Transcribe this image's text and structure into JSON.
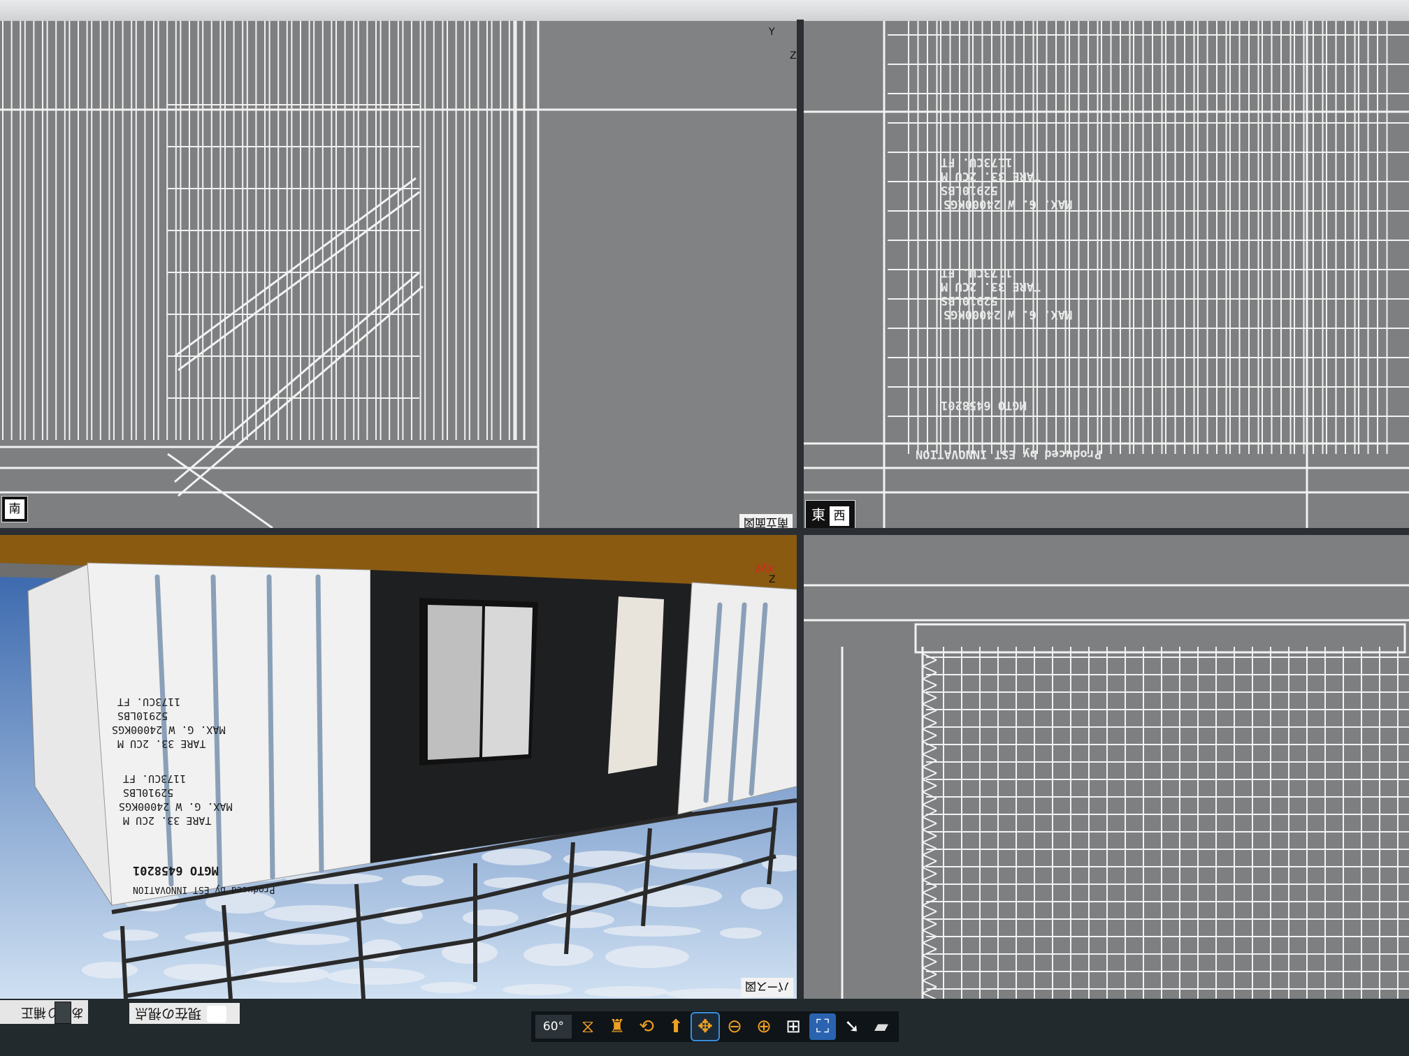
{
  "window": {
    "title": ""
  },
  "viewports": {
    "top_left": {
      "label": "南",
      "corner_label": "南立面図",
      "axis_y": "Y",
      "axis_z": "Z"
    },
    "top_right": {
      "label_a": "東",
      "label_b": "西"
    },
    "bottom_left": {
      "corner_label": "パース図",
      "axis": "xyz",
      "axis_z": "Z"
    },
    "bottom_right": {}
  },
  "container_text": {
    "line1": "MAX. G. W   24000KGS",
    "line2": "52910LBS",
    "line3": "TARE   33. 2CU M",
    "line4": "1173CU. FT",
    "code": "MGTO   6458201",
    "maker": "Produced by EST INNOVATION"
  },
  "bottombar": {
    "left_label": "あおり補正",
    "view_label": "現在の視点",
    "angle": "60°",
    "tools": [
      {
        "name": "tilt-tool",
        "glyph": "⧖"
      },
      {
        "name": "walk-tool",
        "glyph": "♜"
      },
      {
        "name": "orbit-tool",
        "glyph": "⟲"
      },
      {
        "name": "up-tool",
        "glyph": "⬆"
      },
      {
        "name": "pan-tool",
        "glyph": "✥"
      },
      {
        "name": "zoom-out-tool",
        "glyph": "⊖"
      },
      {
        "name": "zoom-in-tool",
        "glyph": "⊕"
      },
      {
        "name": "zoom-window-tool",
        "glyph": "⊞"
      },
      {
        "name": "zoom-extents-tool",
        "glyph": "⛶"
      },
      {
        "name": "pointer-tool",
        "glyph": "➘"
      },
      {
        "name": "render-tool",
        "glyph": "▰"
      }
    ],
    "active_tool": "pan-tool"
  },
  "colors": {
    "accent": "#f0a020",
    "viewport_bg": "#7d7f80",
    "wire": "#f4f4f4",
    "sky": "#3c6fb8",
    "wall_dark": "#1e1f20",
    "beam": "#8a5a10"
  }
}
